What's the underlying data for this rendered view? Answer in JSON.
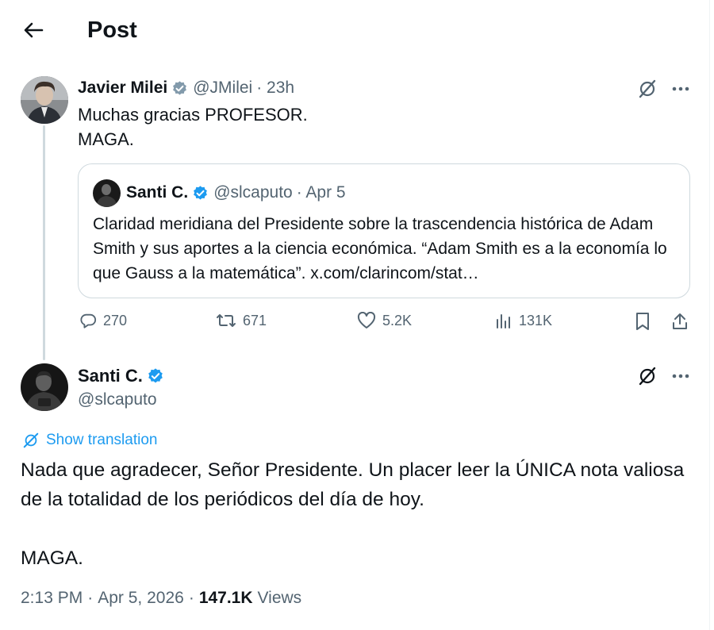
{
  "header": {
    "back_icon": "arrow-left-icon",
    "title": "Post"
  },
  "parent_tweet": {
    "author_name": "Javier Milei",
    "handle": "@JMilei",
    "time": "· 23h",
    "text_line1": "Muchas gracias PROFESOR.",
    "text_line2": "MAGA.",
    "verified_icon": "verified-badge-icon",
    "grok_icon": "grok-icon",
    "more_icon": "more-icon",
    "quote": {
      "author_name": "Santi C.",
      "handle": "@slcaputo",
      "date": "· Apr 5",
      "text": "Claridad meridiana del Presidente sobre la trascendencia histórica de Adam Smith y sus aportes a la ciencia económica. “Adam Smith es a la economía lo que Gauss a la matemática”. x.com/clarincom/stat…"
    },
    "actions": {
      "replies": "270",
      "reposts": "671",
      "likes": "5.2K",
      "views": "131K"
    }
  },
  "main_tweet": {
    "author_name": "Santi C.",
    "handle": "@slcaputo",
    "show_translation": "Show translation",
    "text_para1": "Nada que agradecer, Señor Presidente. Un placer leer la ÚNICA nota valiosa de la totalidad de los periódicos del día de hoy.",
    "text_para2": "MAGA.",
    "time": "2:13 PM",
    "date": "Apr 5, 2026",
    "views_count": "147.1K",
    "views_label": "Views"
  },
  "colors": {
    "text_primary": "#0f1419",
    "text_secondary": "#536471",
    "accent_blue": "#1d9bf0",
    "border": "#cfd9de"
  }
}
